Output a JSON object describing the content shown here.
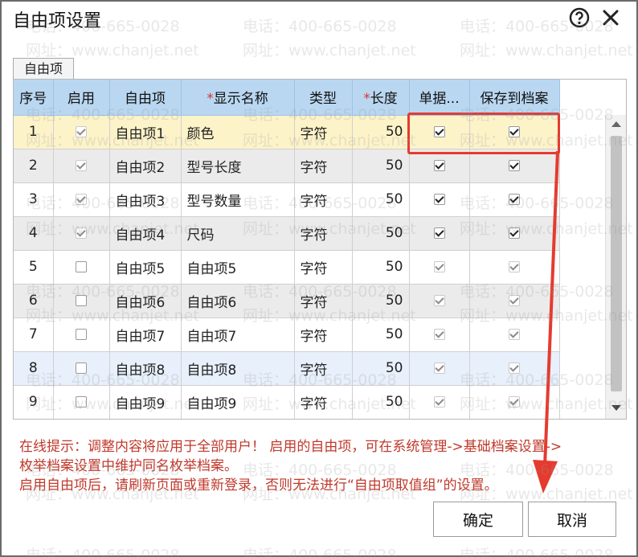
{
  "dialog": {
    "title": "自由项设置"
  },
  "tabs": [
    {
      "label": "自由项"
    }
  ],
  "grid": {
    "columns": [
      {
        "label": "序号",
        "required": false
      },
      {
        "label": "启用",
        "required": false
      },
      {
        "label": "自由项",
        "required": false
      },
      {
        "label": "显示名称",
        "required": true
      },
      {
        "label": "类型",
        "required": false
      },
      {
        "label": "长度",
        "required": true
      },
      {
        "label": "单据...",
        "required": false
      },
      {
        "label": "保存到档案",
        "required": false
      }
    ],
    "rows": [
      {
        "no": "1",
        "enabled": true,
        "item": "自由项1",
        "display_name": "颜色",
        "type": "字符",
        "length": "50",
        "doc": true,
        "save": true
      },
      {
        "no": "2",
        "enabled": true,
        "item": "自由项2",
        "display_name": "型号长度",
        "type": "字符",
        "length": "50",
        "doc": true,
        "save": true
      },
      {
        "no": "3",
        "enabled": true,
        "item": "自由项3",
        "display_name": "型号数量",
        "type": "字符",
        "length": "50",
        "doc": true,
        "save": true
      },
      {
        "no": "4",
        "enabled": true,
        "item": "自由项4",
        "display_name": "尺码",
        "type": "字符",
        "length": "50",
        "doc": true,
        "save": true
      },
      {
        "no": "5",
        "enabled": false,
        "item": "自由项5",
        "display_name": "自由项5",
        "type": "字符",
        "length": "50",
        "doc": true,
        "save": true
      },
      {
        "no": "6",
        "enabled": false,
        "item": "自由项6",
        "display_name": "自由项6",
        "type": "字符",
        "length": "50",
        "doc": true,
        "save": true
      },
      {
        "no": "7",
        "enabled": false,
        "item": "自由项7",
        "display_name": "自由项7",
        "type": "字符",
        "length": "50",
        "doc": true,
        "save": true
      },
      {
        "no": "8",
        "enabled": false,
        "item": "自由项8",
        "display_name": "自由项8",
        "type": "字符",
        "length": "50",
        "doc": true,
        "save": true
      },
      {
        "no": "9",
        "enabled": false,
        "item": "自由项9",
        "display_name": "自由项9",
        "type": "字符",
        "length": "50",
        "doc": true,
        "save": true
      }
    ]
  },
  "tips": {
    "line1": "在线提示：调整内容将应用于全部用户！ 启用的自由项，可在系统管理->基础档案设置->",
    "line2": "枚举档案设置中维护同名枚举档案。",
    "line3": "启用自由项后，请刷新页面或重新登录，否则无法进行“自由项取值组”的设置。"
  },
  "buttons": {
    "ok": "确定",
    "cancel": "取消"
  },
  "watermark": {
    "phone": "电话：400-665-0028",
    "site": "网址：www.chanjet.net"
  },
  "colors": {
    "header_bg": "#b9d7f1",
    "selected_row": "#fdf3c9",
    "annotation_red": "#e53b2e",
    "tip_text": "#c0392b"
  }
}
